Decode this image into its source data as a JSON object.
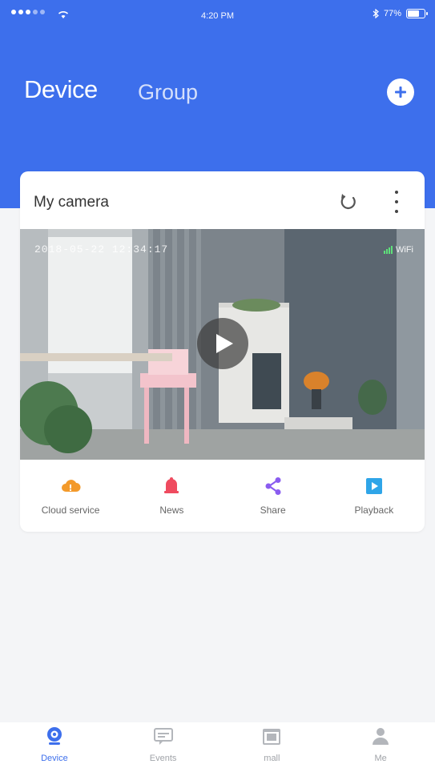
{
  "status_bar": {
    "time": "4:20 PM",
    "battery_percent": "77%",
    "battery_level": 0.77
  },
  "header": {
    "tabs": [
      {
        "label": "Device",
        "active": true
      },
      {
        "label": "Group",
        "active": false
      }
    ],
    "add_icon": "plus-circle-icon"
  },
  "camera_card": {
    "name": "My camera",
    "refresh_icon": "refresh-icon",
    "more_icon": "more-vertical-icon",
    "preview": {
      "timestamp": "2018-05-22 12:34:17",
      "signal_label": "WiFi",
      "play_icon": "play-icon"
    },
    "actions": [
      {
        "label": "Cloud service",
        "icon": "cloud-icon",
        "color": "#f39a2b"
      },
      {
        "label": "News",
        "icon": "bell-icon",
        "color": "#ef4b5f"
      },
      {
        "label": "Share",
        "icon": "share-icon",
        "color": "#8a5cf0"
      },
      {
        "label": "Playback",
        "icon": "playback-icon",
        "color": "#2fa5e8"
      }
    ]
  },
  "bottom_nav": {
    "items": [
      {
        "label": "Device",
        "icon": "camera-icon",
        "active": true
      },
      {
        "label": "Events",
        "icon": "message-icon",
        "active": false
      },
      {
        "label": "mall",
        "icon": "shop-icon",
        "active": false
      },
      {
        "label": "Me",
        "icon": "person-icon",
        "active": false
      }
    ]
  },
  "colors": {
    "primary": "#3d6fec",
    "background": "#f4f5f7",
    "card": "#ffffff",
    "inactive": "#a0a3a8"
  }
}
